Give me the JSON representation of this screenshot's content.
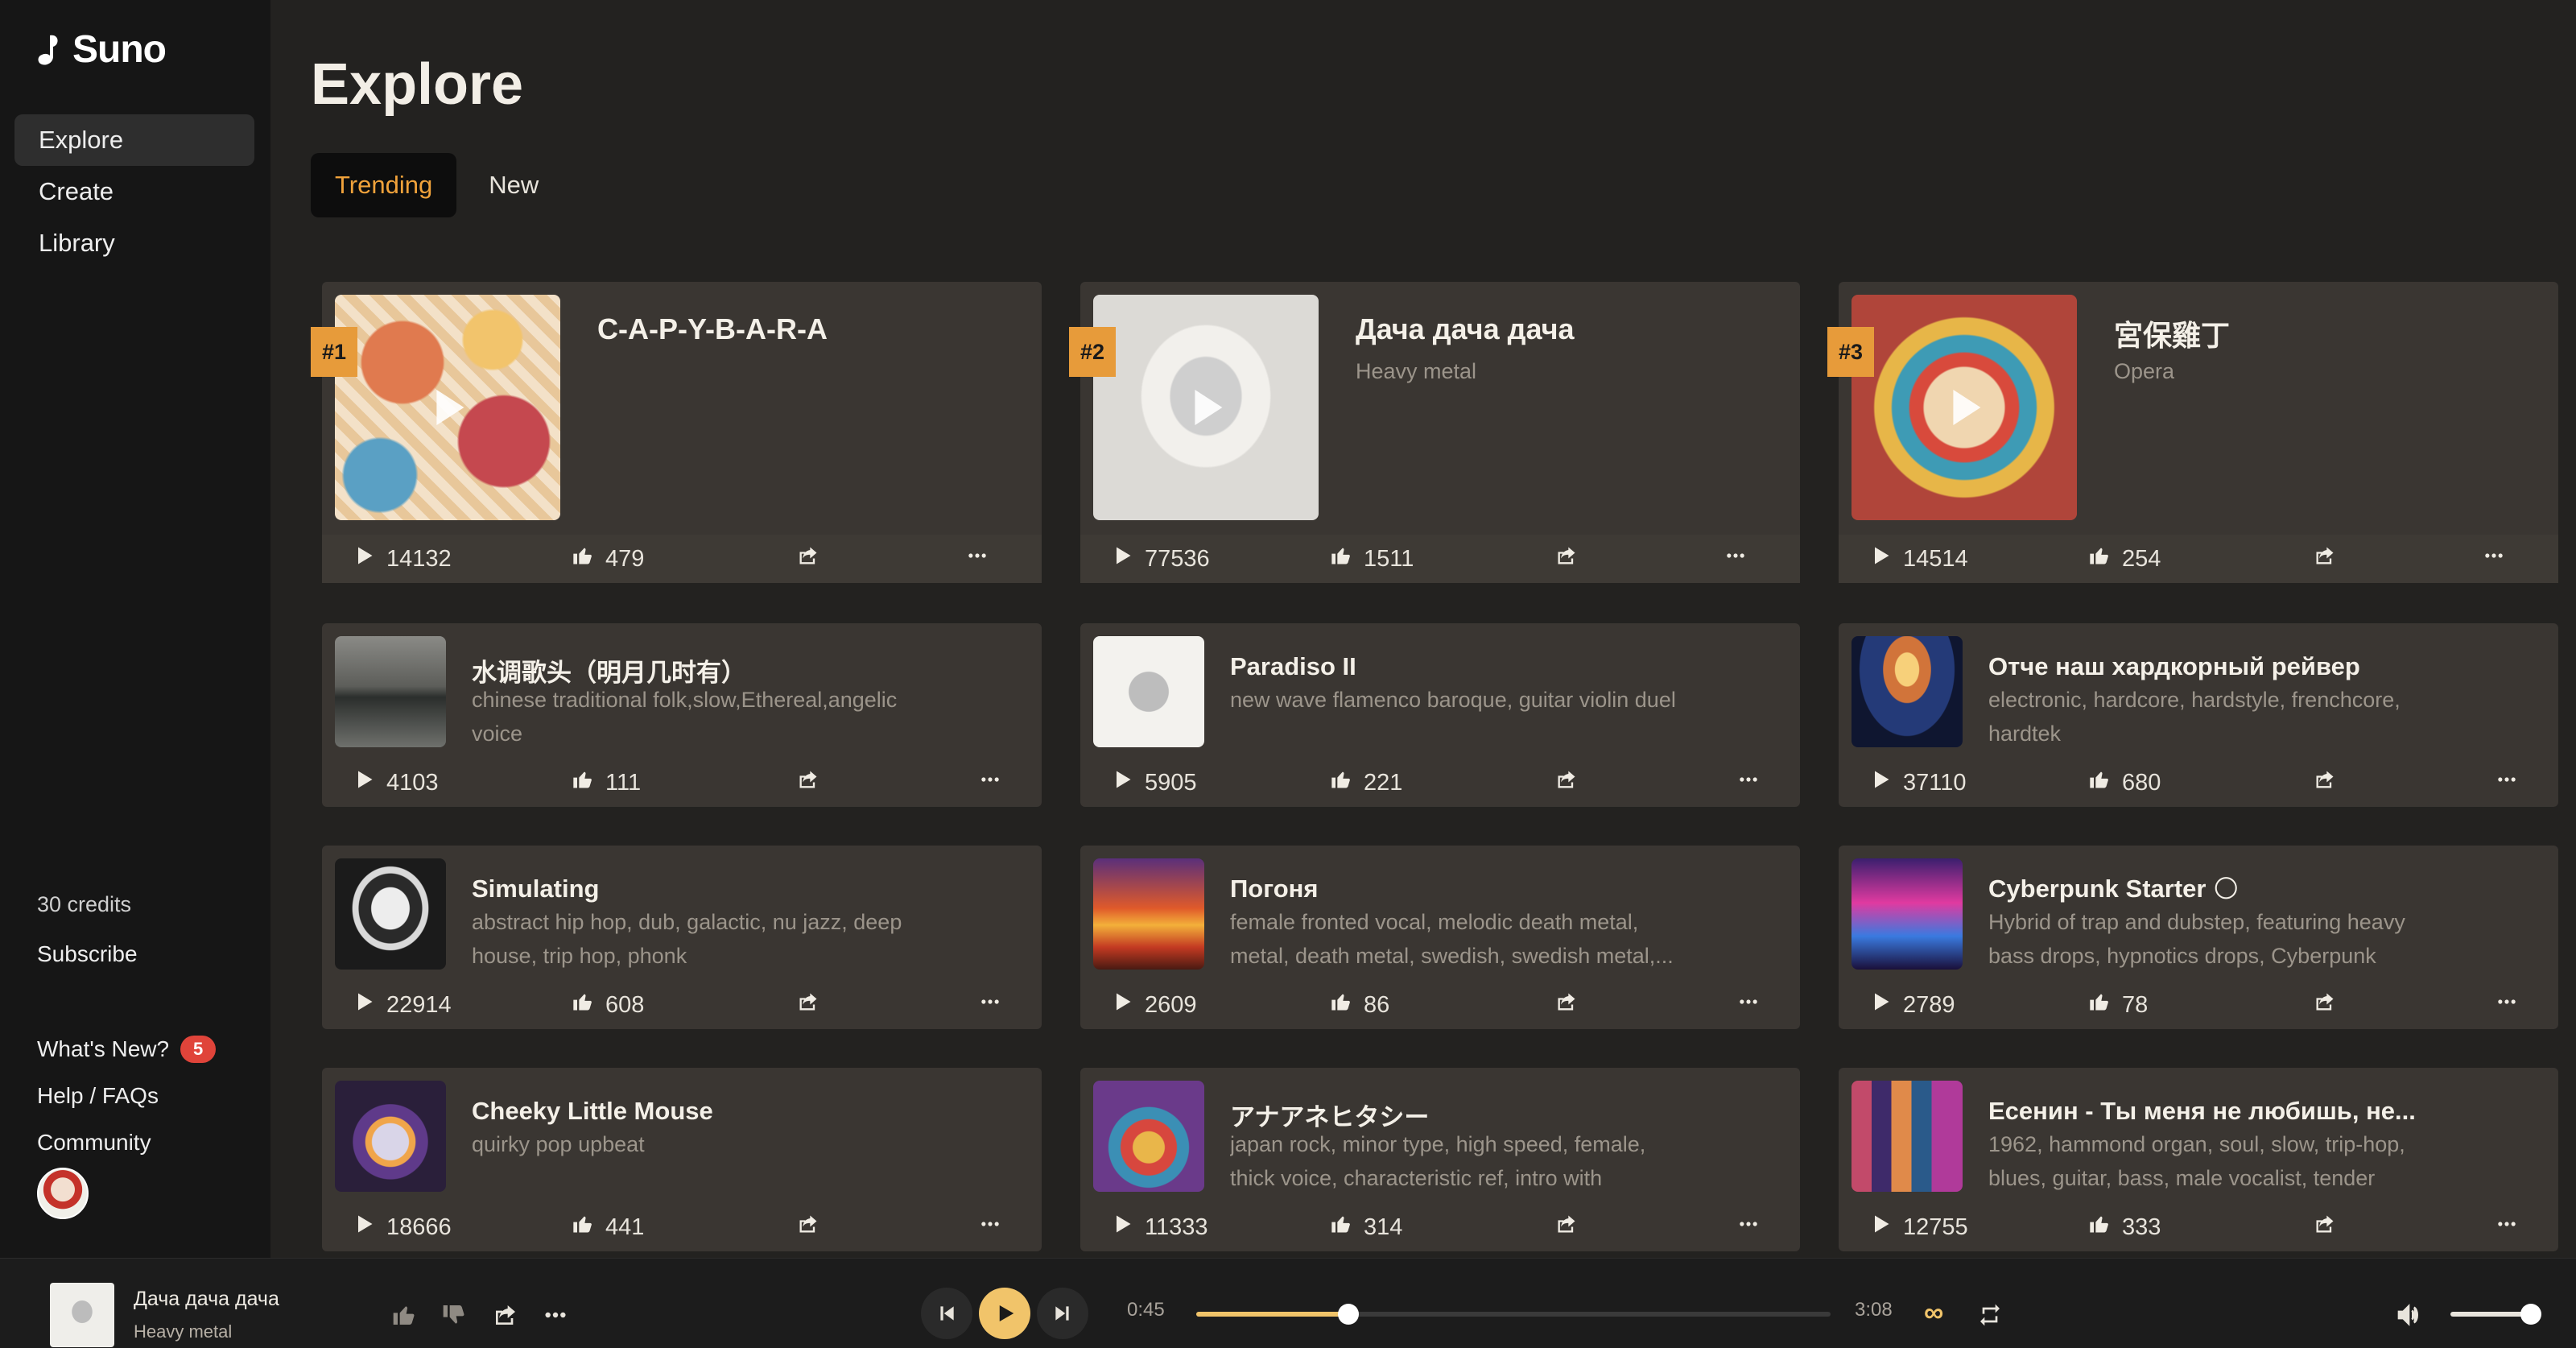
{
  "app": {
    "name": "Suno"
  },
  "sidebar": {
    "nav": [
      {
        "label": "Explore",
        "active": true
      },
      {
        "label": "Create",
        "active": false
      },
      {
        "label": "Library",
        "active": false
      }
    ],
    "credits": "30 credits",
    "subscribe": "Subscribe",
    "whats_new": "What's New?",
    "whats_new_badge": "5",
    "help": "Help / FAQs",
    "community": "Community"
  },
  "main": {
    "title": "Explore",
    "tabs": [
      {
        "label": "Trending",
        "active": true
      },
      {
        "label": "New",
        "active": false
      }
    ]
  },
  "featured": [
    {
      "rank": "#1",
      "title": "C-A-P-Y-B-A-R-A",
      "subtitle": "",
      "plays": "14132",
      "likes": "479",
      "art": "art-capy"
    },
    {
      "rank": "#2",
      "title": "Дача дача дача",
      "subtitle": "Heavy metal",
      "plays": "77536",
      "likes": "1511",
      "art": "art-bird"
    },
    {
      "rank": "#3",
      "title": "宮保雞丁",
      "subtitle": "Opera",
      "plays": "14514",
      "likes": "254",
      "art": "art-mask"
    }
  ],
  "songs": [
    {
      "title": "水调歌头（明月几时有）",
      "subtitle": "chinese traditional folk,slow,Ethereal,angelic voice",
      "plays": "4103",
      "likes": "111",
      "art": "art-lake"
    },
    {
      "title": "Paradiso II",
      "subtitle": "new wave flamenco baroque, guitar violin duel",
      "plays": "5905",
      "likes": "221",
      "art": "art-bird2"
    },
    {
      "title": "Отче наш хардкорный рейвер",
      "subtitle": "electronic, hardcore, hardstyle, frenchcore, hardtek",
      "plays": "37110",
      "likes": "680",
      "art": "art-cathedral"
    },
    {
      "title": "Simulating",
      "subtitle": "abstract hip hop, dub, galactic, nu jazz, deep house, trip hop, phonk",
      "plays": "22914",
      "likes": "608",
      "art": "art-sim"
    },
    {
      "title": "Погоня",
      "subtitle": "female fronted vocal, melodic death metal, metal, death metal, swedish, swedish metal,...",
      "plays": "2609",
      "likes": "86",
      "art": "art-fire"
    },
    {
      "title": "Cyberpunk Starter 🌕",
      "subtitle": "Hybrid of trap and dubstep, featuring heavy bass drops, hypnotics drops, Cyberpunk rhythms, a...",
      "plays": "2789",
      "likes": "78",
      "art": "art-cyber"
    },
    {
      "title": "Cheeky Little Mouse",
      "subtitle": "quirky pop upbeat",
      "plays": "18666",
      "likes": "441",
      "art": "art-mouse"
    },
    {
      "title": "アナアネヒタシー",
      "subtitle": "japan rock, minor type, high speed, female, thick voice, characteristic ref, intro with piano,...",
      "plays": "11333",
      "likes": "314",
      "art": "art-ana"
    },
    {
      "title": "Есенин - Ты меня не любишь, не...",
      "subtitle": "1962, hammond organ, soul, slow, trip-hop, blues, guitar, bass, male vocalist, tender",
      "plays": "12755",
      "likes": "333",
      "art": "art-city"
    }
  ],
  "player": {
    "title": "Дача дача дача",
    "subtitle": "Heavy metal",
    "current_time": "0:45",
    "duration": "3:08",
    "progress_fraction": 0.24,
    "volume_fraction": 1.0,
    "accent_color": "#f1c46a"
  }
}
